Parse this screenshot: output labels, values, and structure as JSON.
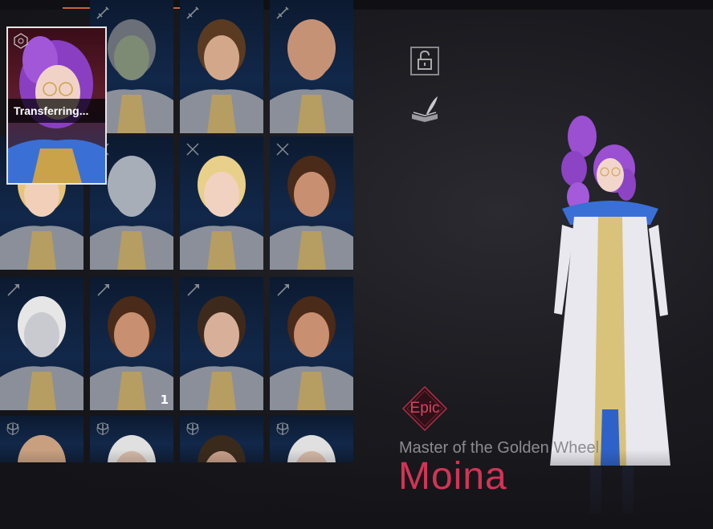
{
  "header": {
    "active_tab_indicator": "orange-underline"
  },
  "selected_card": {
    "status_text": "Transferring...",
    "icon": "class-emblem-icon"
  },
  "side_buttons": {
    "lock_icon": "unlock-icon",
    "collection_icon": "book-quill-icon"
  },
  "grid": {
    "columns": 4,
    "cards": [
      {
        "class_icon": "sword-icon",
        "portrait": "dark-elf-ponytail",
        "count": ""
      },
      {
        "class_icon": "sword-icon",
        "portrait": "human-topknot",
        "count": ""
      },
      {
        "class_icon": "sword-icon",
        "portrait": "bald-dwarf",
        "count": ""
      },
      {
        "class_icon": "crossed-swords-icon",
        "portrait": "blonde-elf",
        "count": ""
      },
      {
        "class_icon": "crossed-swords-icon",
        "portrait": "bald-pale-elf",
        "count": ""
      },
      {
        "class_icon": "crossed-swords-icon",
        "portrait": "blonde-elf-braid",
        "count": ""
      },
      {
        "class_icon": "crossed-swords-icon",
        "portrait": "red-scarf-dwarf",
        "count": ""
      },
      {
        "class_icon": "staff-icon",
        "portrait": "white-hair-elf",
        "count": ""
      },
      {
        "class_icon": "staff-icon",
        "portrait": "bearded-dwarf",
        "count": "1"
      },
      {
        "class_icon": "staff-icon",
        "portrait": "brown-hair-human",
        "count": ""
      },
      {
        "class_icon": "staff-icon",
        "portrait": "braided-dwarf",
        "count": ""
      },
      {
        "class_icon": "trident-icon",
        "portrait": "bald-figure",
        "count": ""
      },
      {
        "class_icon": "trident-icon",
        "portrait": "white-hair-figure",
        "count": ""
      },
      {
        "class_icon": "trident-icon",
        "portrait": "topknot-figure",
        "count": ""
      },
      {
        "class_icon": "trident-icon",
        "portrait": "white-hair-figure",
        "count": ""
      }
    ]
  },
  "character": {
    "grade": "Epic",
    "epithet": "Master of the Golden Wheel",
    "name": "Moina",
    "colors": {
      "grade": "#d44560",
      "name": "#d23456",
      "hair": "#9b4fd1",
      "robe": "#e8e8ee",
      "accent": "#3a6fd6",
      "gold": "#c9a24a"
    }
  }
}
